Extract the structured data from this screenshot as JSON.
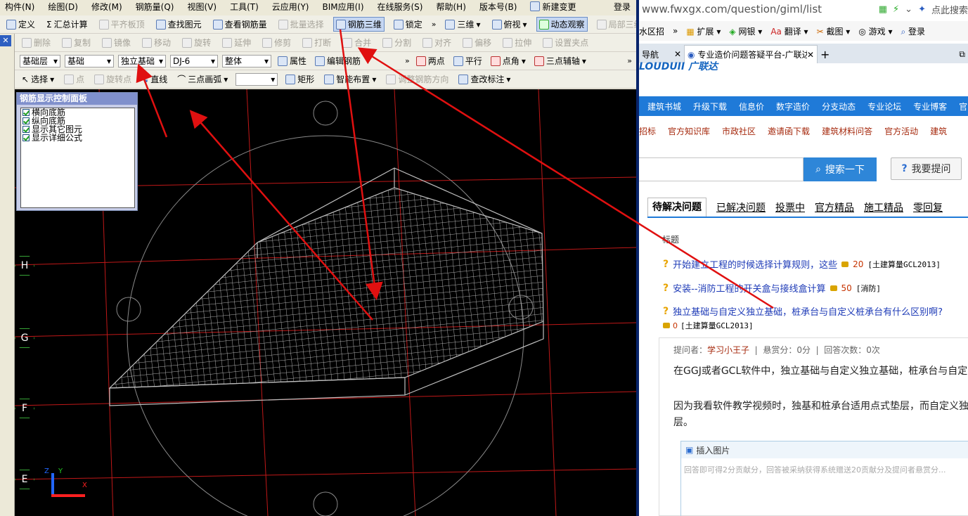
{
  "menubar": {
    "items": [
      "构件(N)",
      "绘图(D)",
      "修改(M)",
      "钢筋量(Q)",
      "视图(V)",
      "工具(T)",
      "云应用(Y)",
      "BIM应用(I)",
      "在线服务(S)",
      "帮助(H)",
      "版本号(B)"
    ],
    "new_change": "新建变更",
    "login": "登录"
  },
  "toolbar1": {
    "define": "定义",
    "summary": "汇总计算",
    "flush_slab": "平齐板顶",
    "find_element": "查找图元",
    "view_rebar": "查看钢筋量",
    "batch_select": "批量选择",
    "rebar_3d": "钢筋三维",
    "lock": "锁定",
    "view_3d": "三维",
    "top_view": "俯视",
    "dynamic_view": "动态观察",
    "local_3d": "局部三维"
  },
  "toolbar2": {
    "delete": "删除",
    "copy": "复制",
    "mirror": "镜像",
    "move": "移动",
    "rotate": "旋转",
    "extend": "延伸",
    "trim": "修剪",
    "break": "打断",
    "merge": "合并",
    "split": "分割",
    "align": "对齐",
    "offset": "偏移",
    "stretch": "拉伸",
    "set_grip": "设置夹点"
  },
  "toolbar3": {
    "layer": "基础层",
    "category": "基础",
    "element_type": "独立基础",
    "element_name": "DJ-6",
    "scope": "整体",
    "properties": "属性",
    "edit_rebar": "编辑钢筋",
    "two_points": "两点",
    "parallel": "平行",
    "point_angle": "点角",
    "three_point_axis": "三点辅轴"
  },
  "toolbar4": {
    "select": "选择",
    "point": "点",
    "rotate_point": "旋转点",
    "line": "直线",
    "three_point_arc": "三点画弧",
    "rectangle": "矩形",
    "smart_layout": "智能布置",
    "adjust_rebar_dir": "调整钢筋方向",
    "change_label": "查改标注"
  },
  "panel": {
    "title": "钢筋显示控制面板",
    "options": [
      "横向底筋",
      "纵向底筋",
      "显示其它图元",
      "显示详细公式"
    ]
  },
  "axis_labels": [
    "H",
    "G",
    "F",
    "E"
  ],
  "coord_labels": {
    "z": "Z",
    "y": "Y",
    "x": "X"
  },
  "browser": {
    "url": "www.fwxgx.com/question/giml/list",
    "search_hint": "点此搜索",
    "favs": [
      "水区招",
      "扩展",
      "网银",
      "翻译",
      "截图",
      "游戏",
      "登录"
    ],
    "tab_left": "导航",
    "tab_active": "专业造价问题答疑平台-广联达",
    "logo": "LOUDUII 广联达",
    "nav1": [
      "建筑书城",
      "升级下载",
      "信息价",
      "数字造价",
      "分支动态",
      "专业论坛",
      "专业博客",
      "官"
    ],
    "nav2": [
      "招标",
      "官方知识库",
      "市政社区",
      "邀请函下载",
      "建筑材料问答",
      "官方活动",
      "建筑"
    ],
    "search_btn": "搜索一下",
    "ask_btn": "我要提问",
    "qtabs": [
      "待解决问题",
      "已解决问题",
      "投票中",
      "官方精品",
      "施工精品",
      "零回复"
    ],
    "col_title": "标题",
    "questions": [
      {
        "title": "开始建立工程的时候选择计算规则，这些",
        "score": "20",
        "tag": "[土建算量GCL2013]"
      },
      {
        "title": "安装--消防工程的开关盒与接线盒计算",
        "score": "50",
        "tag": "[消防]"
      },
      {
        "title": "独立基础与自定义独立基础，桩承台与自定义桩承台有什么区别啊?",
        "score": "0",
        "tag": "[土建算量GCL2013]"
      }
    ],
    "detail": {
      "asker_label": "提问者：",
      "asker": "学习小王子",
      "reward": "悬赏分：0分",
      "answers": "回答次数：0次",
      "para1": "在GGJ或者GCL软件中，独立基础与自定义独立基础，桩承台与自定",
      "para2": "因为我看软件教学视频时，独基和桩承台适用点式垫层，而自定义独",
      "para3": "层。",
      "insert_image": "插入图片",
      "placeholder": "回答即可得2分贡献分，回答被采纳获得系统赠送20贡献分及提问者悬赏分..."
    }
  },
  "colors": {
    "accent": "#1f7ad8",
    "arrow": "#e01010",
    "grid": "#c01818",
    "mesh": "#b0b0b0"
  }
}
